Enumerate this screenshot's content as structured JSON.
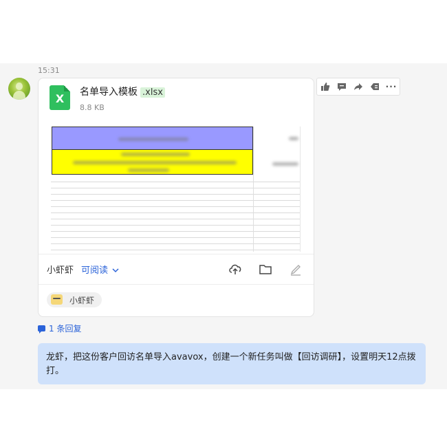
{
  "message": {
    "time": "15:31",
    "file": {
      "name": "名单导入模板",
      "extension": ".xlsx",
      "size": "8.8 KB",
      "icon": "excel-icon",
      "icon_letter": "X"
    },
    "owner": "小虾虾",
    "permission": "可阅读",
    "tag_label": "小虾虾",
    "reply_count": "1 条回复",
    "actions": [
      "thumbs-up-icon",
      "comment-icon",
      "forward-icon",
      "bookmark-icon",
      "more-icon"
    ],
    "more_glyph": "···"
  },
  "reply": {
    "text": "龙虾，把这份客户回访名单导入avavox，创建一个新任务叫做【回访调研】，设置明天12点拨打。"
  },
  "colors": {
    "link": "#2b63d9",
    "bubble": "#cfe1fb",
    "excel_green": "#2fbf5e",
    "row_purple": "#9999ff",
    "row_yellow": "#ffff00"
  }
}
